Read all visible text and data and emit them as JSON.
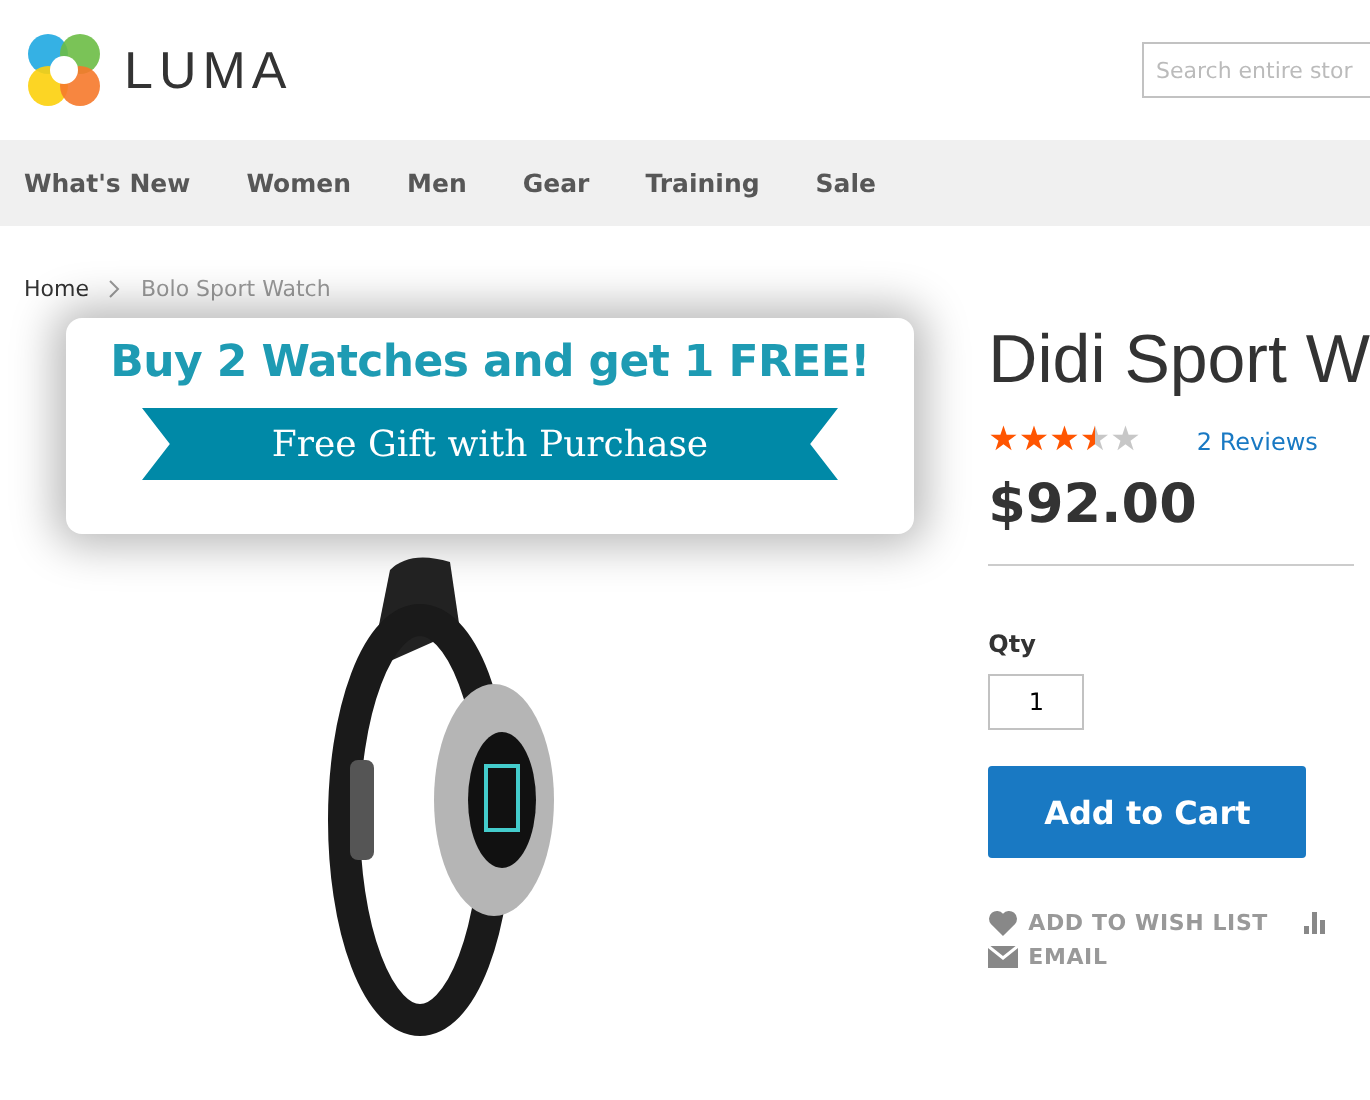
{
  "header": {
    "logo_text": "LUMA",
    "search": {
      "placeholder": "Search entire stor"
    }
  },
  "nav": [
    {
      "label": "What's New"
    },
    {
      "label": "Women"
    },
    {
      "label": "Men"
    },
    {
      "label": "Gear"
    },
    {
      "label": "Training"
    },
    {
      "label": "Sale"
    }
  ],
  "breadcrumbs": [
    {
      "label": "Home",
      "kind": "link"
    },
    {
      "label": "Bolo Sport Watch",
      "kind": "current"
    }
  ],
  "promo": {
    "headline": "Buy 2 Watches and get 1 FREE!",
    "ribbon": "Free Gift with Purchase"
  },
  "product": {
    "title": "Didi Sport W",
    "stars": 3.5,
    "reviews": "2 Reviews",
    "price": "$92.00",
    "qty_label": "Qty",
    "qty": "1",
    "add_to_cart": "Add to Cart",
    "actions": [
      {
        "label": "ADD TO WISH LIST",
        "kind": "wishlist"
      },
      {
        "kind": "compare"
      },
      {
        "label": "EMAIL",
        "kind": "email"
      }
    ]
  }
}
